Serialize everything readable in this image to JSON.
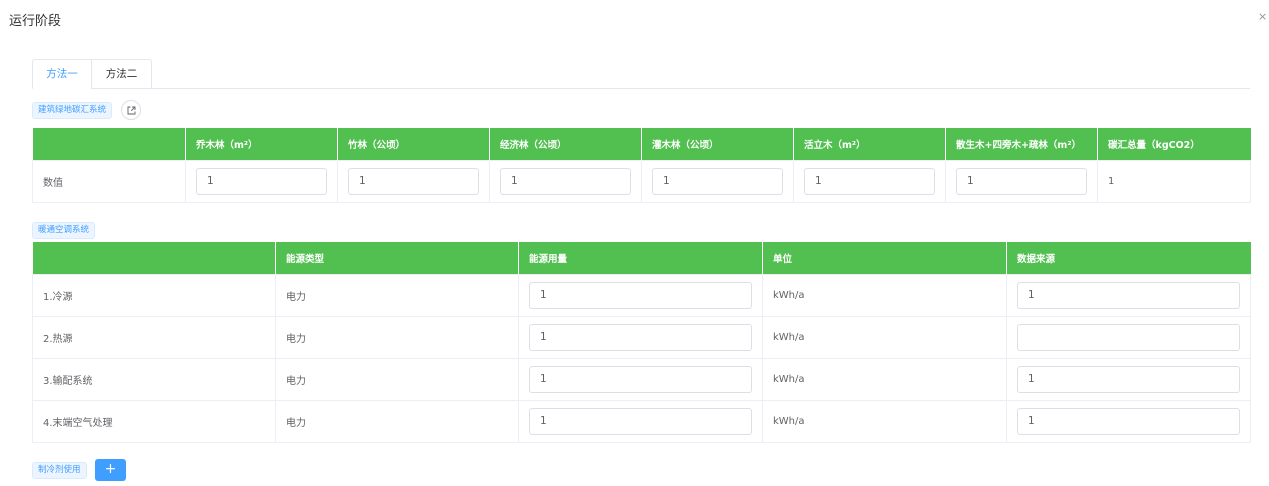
{
  "dialog": {
    "title": "运行阶段",
    "close_glyph": "×"
  },
  "tabs": [
    {
      "label": "方法一",
      "active": true
    },
    {
      "label": "方法二",
      "active": false
    }
  ],
  "green_section": {
    "tag_label": "建筑绿地碳汇系统",
    "headers": [
      "",
      "乔木林（m²）",
      "竹林（公顷）",
      "经济林（公顷）",
      "灌木林（公顷）",
      "活立木（m²）",
      "散生木+四旁木+疏林（m²）",
      "碳汇总量（kgCO2）"
    ],
    "row": {
      "label": "数值",
      "values": [
        "1",
        "1",
        "1",
        "1",
        "1",
        "1"
      ],
      "total": "1"
    }
  },
  "hvac_section": {
    "tag_label": "暖通空调系统",
    "headers": [
      "",
      "能源类型",
      "能源用量",
      "单位",
      "数据来源"
    ],
    "rows": [
      {
        "name": "1.冷源",
        "energy_type": "电力",
        "usage": "1",
        "unit": "kWh/a",
        "source": "1"
      },
      {
        "name": "2.热源",
        "energy_type": "电力",
        "usage": "1",
        "unit": "kWh/a",
        "source": ""
      },
      {
        "name": "3.输配系统",
        "energy_type": "电力",
        "usage": "1",
        "unit": "kWh/a",
        "source": "1"
      },
      {
        "name": "4.末端空气处理",
        "energy_type": "电力",
        "usage": "1",
        "unit": "kWh/a",
        "source": "1"
      }
    ]
  },
  "refrigerant": {
    "tag_label": "制冷剂使用",
    "add_label": "+"
  },
  "colors": {
    "header_green": "#52c051",
    "primary_blue": "#409eff"
  }
}
